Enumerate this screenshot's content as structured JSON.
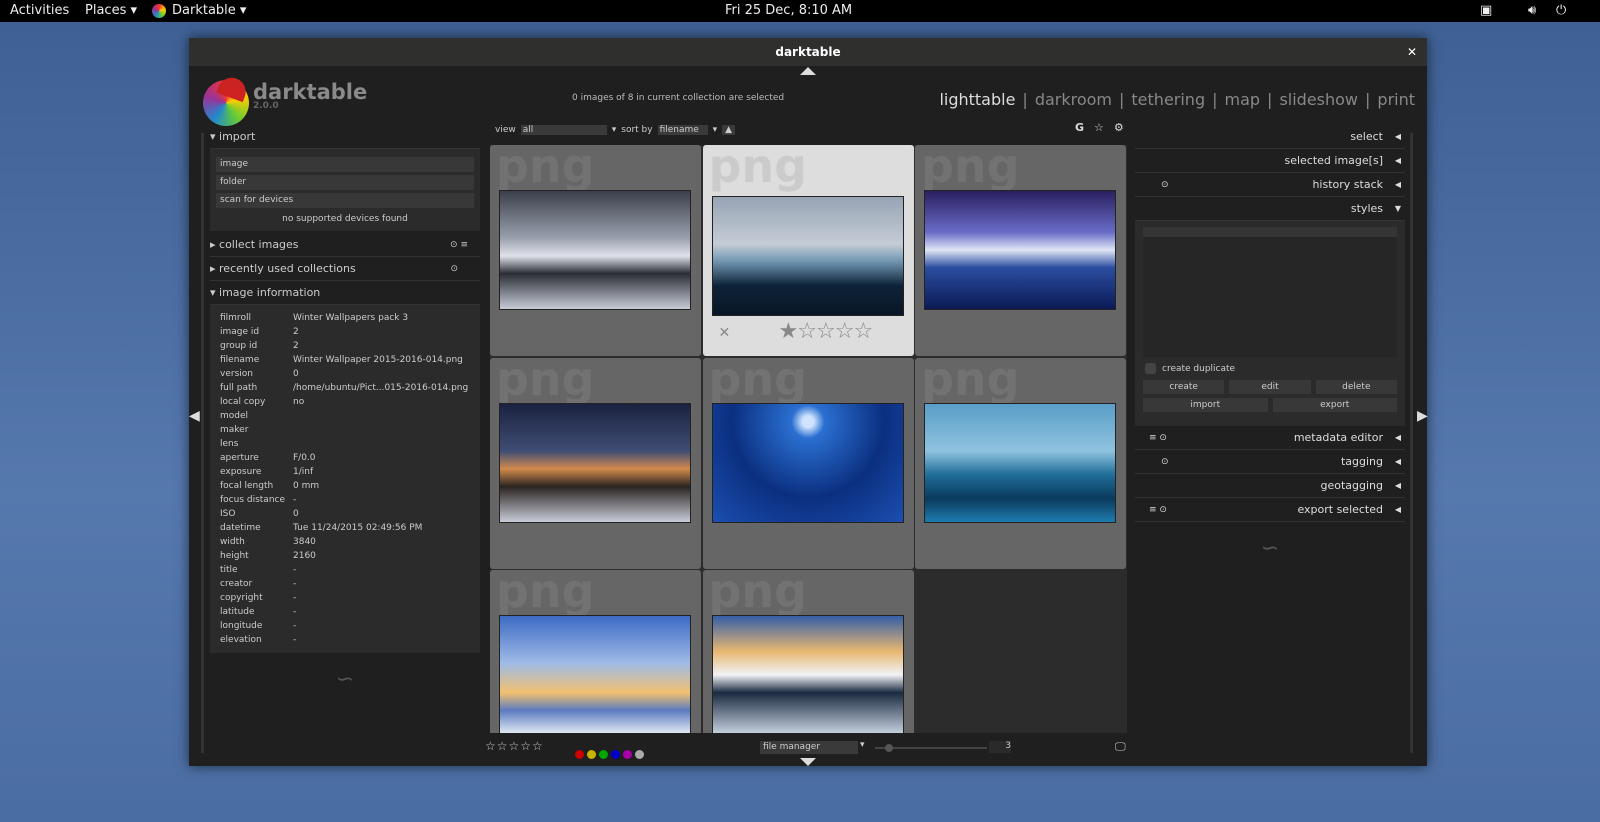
{
  "topbar": {
    "activities": "Activities",
    "places": "Places ▾",
    "app": "Darktable ▾",
    "clock": "Fri 25 Dec,  8:10 AM"
  },
  "window": {
    "title": "darktable",
    "close": "✕"
  },
  "brand": {
    "name": "darktable",
    "version": "2.0.0"
  },
  "views": [
    "lighttable",
    "darkroom",
    "tethering",
    "map",
    "slideshow",
    "print"
  ],
  "selection_status": "0 images of 8 in current collection are selected",
  "toolbar": {
    "view_label": "view",
    "view_value": "all",
    "sort_label": "sort by",
    "sort_value": "filename",
    "g": "G"
  },
  "left": {
    "import": {
      "title": "import",
      "buttons": [
        "image",
        "folder",
        "scan for devices"
      ],
      "status": "no supported devices found"
    },
    "collect": "collect images",
    "recent": "recently used collections",
    "info_title": "image information",
    "info": [
      [
        "filmroll",
        "Winter Wallpapers pack 3"
      ],
      [
        "image id",
        "2"
      ],
      [
        "group id",
        "2"
      ],
      [
        "filename",
        "Winter Wallpaper 2015-2016-014.png"
      ],
      [
        "version",
        "0"
      ],
      [
        "full path",
        "/home/ubuntu/Pict...015-2016-014.png"
      ],
      [
        "local copy",
        "no"
      ],
      [
        "model",
        ""
      ],
      [
        "maker",
        ""
      ],
      [
        "lens",
        ""
      ],
      [
        "aperture",
        "F/0.0"
      ],
      [
        "exposure",
        "1/inf"
      ],
      [
        "focal length",
        "0 mm"
      ],
      [
        "focus distance",
        "-"
      ],
      [
        "ISO",
        "0"
      ],
      [
        "datetime",
        "Tue 11/24/2015 02:49:56 PM"
      ],
      [
        "width",
        "3840"
      ],
      [
        "height",
        "2160"
      ],
      [
        "title",
        "-"
      ],
      [
        "creator",
        "-"
      ],
      [
        "copyright",
        "-"
      ],
      [
        "latitude",
        "-"
      ],
      [
        "longitude",
        "-"
      ],
      [
        "elevation",
        "-"
      ]
    ]
  },
  "grid": {
    "watermark": "png",
    "thumbs": [
      {
        "g": "linear-gradient(180deg,#3a3f4a,#9aa0ad 40%,#e0e2ea 55%,#2a2d35 70%,#c8ccd6)"
      },
      {
        "g": "linear-gradient(180deg,#98a4b4,#c4ccd6 40%,#6f94b0 55%,#0e2338 75%,#081626)"
      },
      {
        "g": "linear-gradient(180deg,#2a2060,#6a6cc8 35%,#dfe6f5 50%,#2b4da0 65%,#0b1a55)"
      },
      {
        "g": "linear-gradient(180deg,#1a2240,#404d74 40%,#d28a4c 55%,#2a2420 70%,#c8ccd8)"
      },
      {
        "g": "radial-gradient(circle at 50% 15%,#cfe3ff 4%,#2a6fd0 12%,#0b2f80 55%,#1b4fb0)"
      },
      {
        "g": "linear-gradient(180deg,#5a9ec8,#8fc3df 40%,#1f6d99 60%,#0b3a5c 80%,#1d7cb0)"
      },
      {
        "g": "linear-gradient(180deg,#3d6bc4,#9fbbe6 40%,#f2c070 65%,#5b7bc0 80%,#e6ecf5)"
      },
      {
        "g": "linear-gradient(180deg,#355ea8,#e8b870 30%,#f0f2f6 50%,#1a2a40 65%,#c8d2e0)"
      }
    ],
    "highlighted_rating": 1,
    "reject": "✕"
  },
  "bottom": {
    "layout": "file manager",
    "zoom": "3"
  },
  "color_labels": [
    "#cc0000",
    "#c8b400",
    "#00a800",
    "#0000cc",
    "#aa00aa",
    "#aaaaaa"
  ],
  "right": {
    "sections_top": [
      "select",
      "selected image[s]",
      "history stack",
      "styles"
    ],
    "create_duplicate": "create duplicate",
    "style_buttons": [
      "create",
      "edit",
      "delete"
    ],
    "style_buttons2": [
      "import",
      "export"
    ],
    "sections_bottom": [
      "metadata editor",
      "tagging",
      "geotagging",
      "export selected"
    ]
  }
}
